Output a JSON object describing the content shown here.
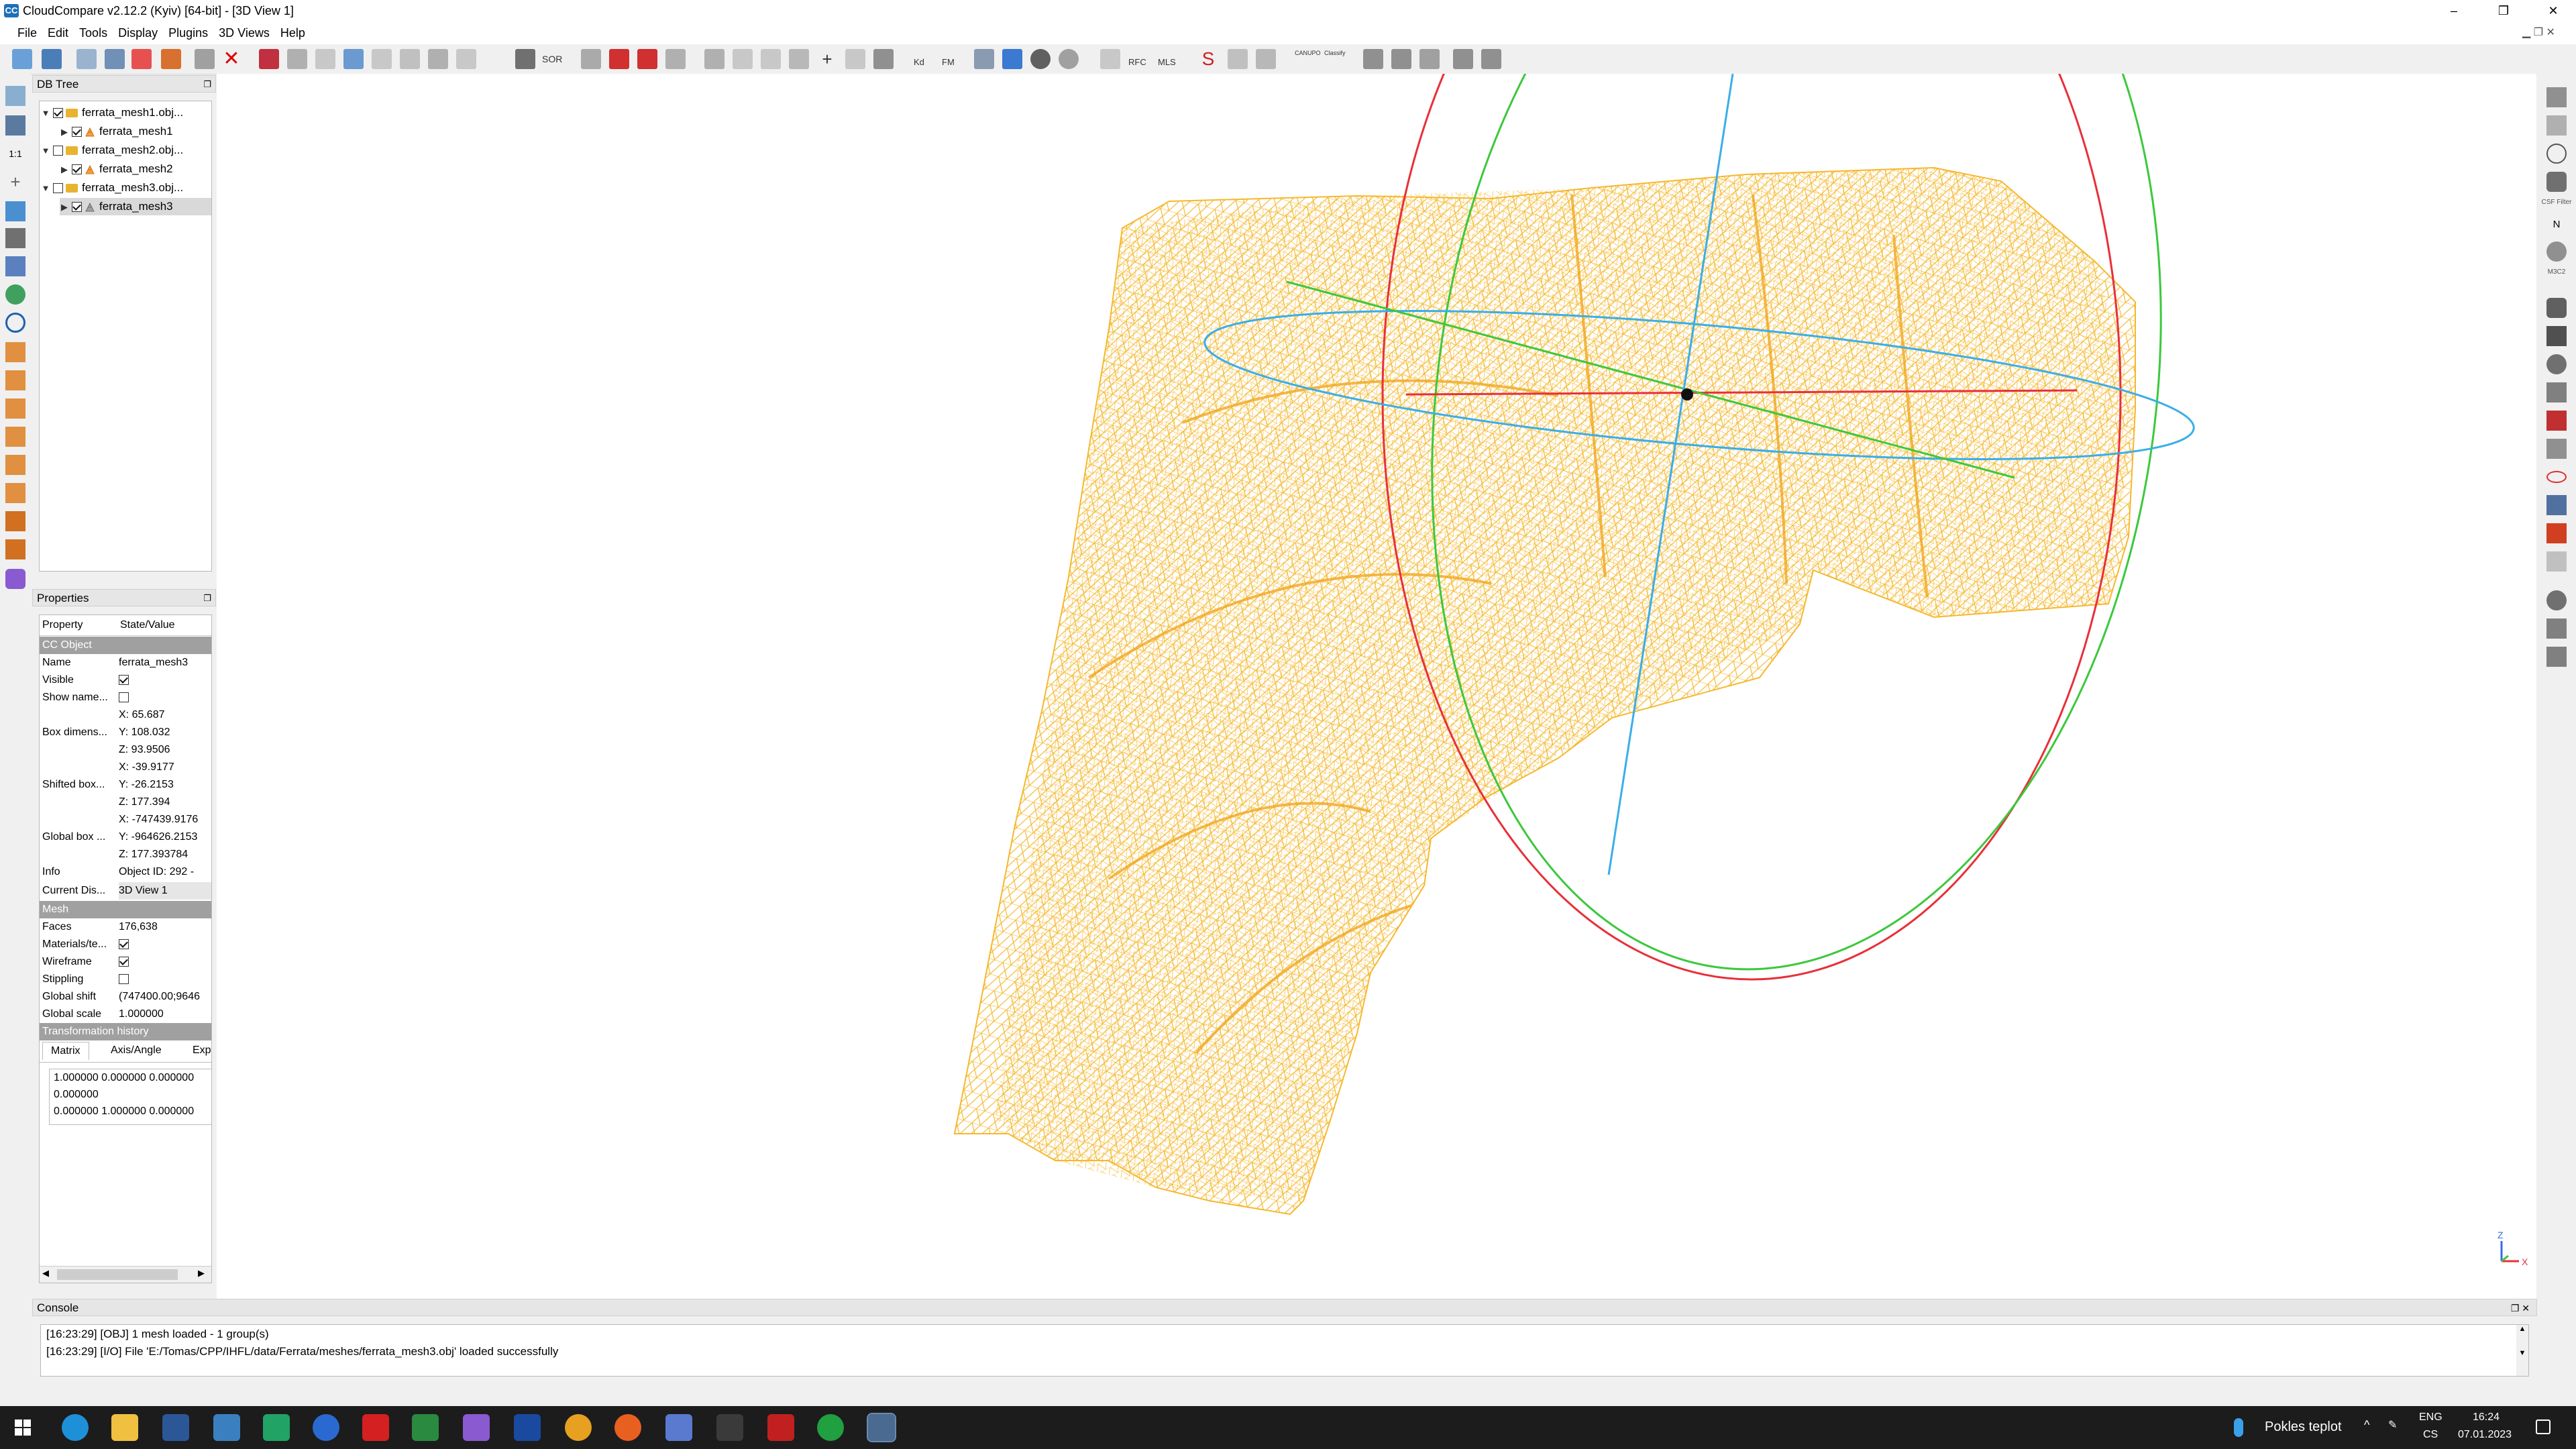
{
  "window": {
    "title": "CloudCompare v2.12.2 (Kyiv) [64-bit] - [3D View 1]",
    "minimize": "–",
    "restore": "❐",
    "close": "✕"
  },
  "menubar": [
    "File",
    "Edit",
    "Tools",
    "Display",
    "Plugins",
    "3D Views",
    "Help"
  ],
  "toolbar_labels": {
    "sor": "SOR",
    "kd": "Kd",
    "fm": "FM",
    "rfc": "RFC",
    "mls": "MLS",
    "canupo": "CANUPO",
    "classify": "Classify"
  },
  "right_toolbar_labels": {
    "csf_filter": "CSF Filter",
    "n": "N",
    "m3c2": "M3C2"
  },
  "db_tree": {
    "title": "DB Tree",
    "items": [
      {
        "label": "ferrata_mesh1.obj...",
        "type": "folder",
        "checked": true,
        "expanded": true,
        "level": 0
      },
      {
        "label": "ferrata_mesh1",
        "type": "mesh",
        "checked": true,
        "level": 1
      },
      {
        "label": "ferrata_mesh2.obj...",
        "type": "folder",
        "checked": false,
        "expanded": true,
        "level": 0
      },
      {
        "label": "ferrata_mesh2",
        "type": "mesh",
        "checked": true,
        "level": 1
      },
      {
        "label": "ferrata_mesh3.obj...",
        "type": "folder",
        "checked": false,
        "expanded": true,
        "level": 0
      },
      {
        "label": "ferrata_mesh3",
        "type": "mesh",
        "checked": true,
        "level": 1,
        "selected": true
      }
    ]
  },
  "properties": {
    "title": "Properties",
    "col_property": "Property",
    "col_value": "State/Value",
    "section_cc_object": "CC Object",
    "name_label": "Name",
    "name_value": "ferrata_mesh3",
    "visible_label": "Visible",
    "visible_checked": true,
    "show_name_label": "Show name...",
    "show_name_checked": false,
    "box_dim_label": "Box dimens...",
    "box_dim_x": "X: 65.687",
    "box_dim_y": "Y: 108.032",
    "box_dim_z": "Z: 93.9506",
    "shifted_box_label": "Shifted box...",
    "shifted_x": "X: -39.9177",
    "shifted_y": "Y: -26.2153",
    "shifted_z": "Z: 177.394",
    "global_box_label": "Global box ...",
    "global_x": "X: -747439.9176",
    "global_y": "Y: -964626.2153",
    "global_z": "Z: 177.393784",
    "info_label": "Info",
    "info_value": "Object ID: 292 -",
    "current_display_label": "Current Dis...",
    "current_display_value": "3D View 1",
    "section_mesh": "Mesh",
    "faces_label": "Faces",
    "faces_value": "176,638",
    "materials_label": "Materials/te...",
    "materials_checked": true,
    "wireframe_label": "Wireframe",
    "wireframe_checked": true,
    "stippling_label": "Stippling",
    "stippling_checked": false,
    "global_shift_label": "Global shift",
    "global_shift_value": "(747400.00;9646",
    "global_scale_label": "Global scale",
    "global_scale_value": "1.000000",
    "section_transform": "Transformation history",
    "tabs": [
      "Matrix",
      "Axis/Angle",
      "Exp"
    ],
    "matrix_lines": [
      "1.000000 0.000000 0.000000",
      "0.000000",
      "0.000000 1.000000 0.000000"
    ]
  },
  "console": {
    "title": "Console",
    "lines": [
      "[16:23:29] [OBJ] 1 mesh loaded - 1 group(s)",
      "[16:23:29] [I/O] File 'E:/Tomas/CPP/IHFL/data/Ferrata/meshes/ferrata_mesh3.obj' loaded successfully"
    ]
  },
  "viewport": {
    "axis_z": "Z",
    "axis_x": "X",
    "mesh_color": "#f5b82e",
    "gizmo_red": "#e8303a",
    "gizmo_green": "#3cc83c",
    "gizmo_blue": "#3aaee8"
  },
  "taskbar": {
    "weather": "Pokles teplot",
    "lang1": "ENG",
    "lang2": "CS",
    "time": "16:24",
    "date": "07.01.2023"
  }
}
